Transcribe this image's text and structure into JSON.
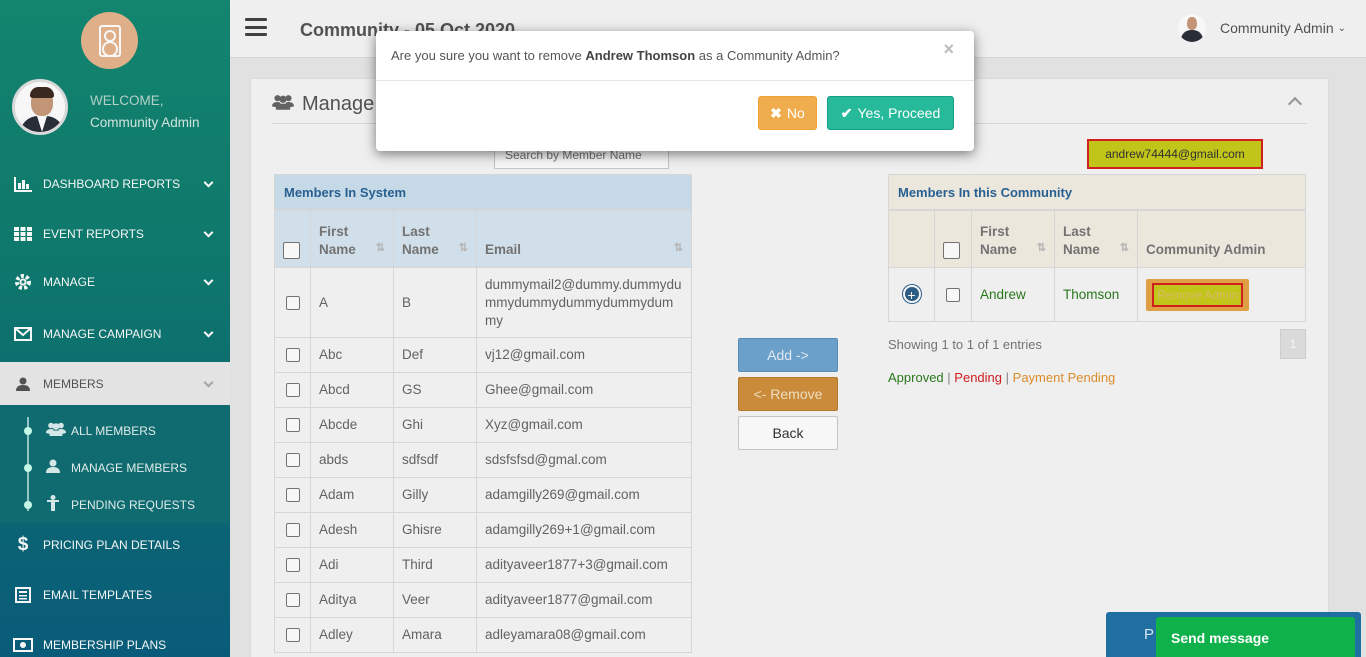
{
  "sidebar": {
    "welcome_label": "WELCOME,",
    "user_name": "Community Admin",
    "menu": [
      {
        "label": "DASHBOARD REPORTS",
        "icon": "bar-chart-icon"
      },
      {
        "label": "EVENT REPORTS",
        "icon": "grid-icon"
      },
      {
        "label": "MANAGE",
        "icon": "gear-icon"
      },
      {
        "label": "MANAGE CAMPAIGN",
        "icon": "envelope-icon"
      },
      {
        "label": "MEMBERS",
        "icon": "user-icon"
      },
      {
        "label": "PRICING PLAN DETAILS",
        "icon": "dollar-icon"
      },
      {
        "label": "EMAIL TEMPLATES",
        "icon": "template-icon"
      },
      {
        "label": "MEMBERSHIP PLANS",
        "icon": "money-icon"
      }
    ],
    "submenu": [
      {
        "label": "ALL MEMBERS",
        "icon": "users-icon"
      },
      {
        "label": "MANAGE MEMBERS",
        "icon": "user-icon"
      },
      {
        "label": "PENDING REQUESTS",
        "icon": "person-icon"
      }
    ]
  },
  "topbar": {
    "title": "Community - 05 Oct 2020",
    "user_label": "Community Admin"
  },
  "panel": {
    "title": "Manage",
    "search_placeholder": "Search by Member Name",
    "email_tag": "andrew74444@gmail.com"
  },
  "left_table": {
    "caption": "Members In System",
    "headers": [
      "First Name",
      "Last Name",
      "Email"
    ],
    "rows": [
      {
        "first": "A",
        "last": "B",
        "email": "dummymail2@dummy.dummydummydummydummydummydummy"
      },
      {
        "first": "Abc",
        "last": "Def",
        "email": "vj12@gmail.com"
      },
      {
        "first": "Abcd",
        "last": "GS",
        "email": "Ghee@gmail.com"
      },
      {
        "first": "Abcde",
        "last": "Ghi",
        "email": "Xyz@gmail.com"
      },
      {
        "first": "abds",
        "last": "sdfsdf",
        "email": "sdsfsfsd@gmal.com"
      },
      {
        "first": "Adam",
        "last": "Gilly",
        "email": "adamgilly269@gmail.com"
      },
      {
        "first": "Adesh",
        "last": "Ghisre",
        "email": "adamgilly269+1@gmail.com"
      },
      {
        "first": "Adi",
        "last": "Third",
        "email": "adityaveer1877+3@gmail.com"
      },
      {
        "first": "Aditya",
        "last": "Veer",
        "email": "adityaveer1877@gmail.com"
      },
      {
        "first": "Adley",
        "last": "Amara",
        "email": "adleyamara08@gmail.com"
      }
    ]
  },
  "middle_buttons": {
    "add": "Add ->",
    "remove": "<- Remove",
    "back": "Back"
  },
  "right_table": {
    "caption": "Members In this Community",
    "headers": [
      "First Name",
      "Last Name",
      "Community Admin"
    ],
    "rows": [
      {
        "first": "Andrew",
        "last": "Thomson",
        "action": "Remove Admin"
      }
    ],
    "showing": "Showing 1 to 1 of 1 entries",
    "page": "1"
  },
  "legend": {
    "approved": "Approved",
    "pending": "Pending",
    "payment_pending": "Payment Pending",
    "separator": "|"
  },
  "modal": {
    "message_prefix": "Are you sure you want to remove ",
    "member_name": "Andrew Thomson",
    "message_suffix": " as a Community Admin?",
    "close": "×",
    "no_label": "No",
    "yes_label": "Yes, Proceed"
  },
  "widgets": {
    "blue_label": "P",
    "send_message": "Send message"
  }
}
